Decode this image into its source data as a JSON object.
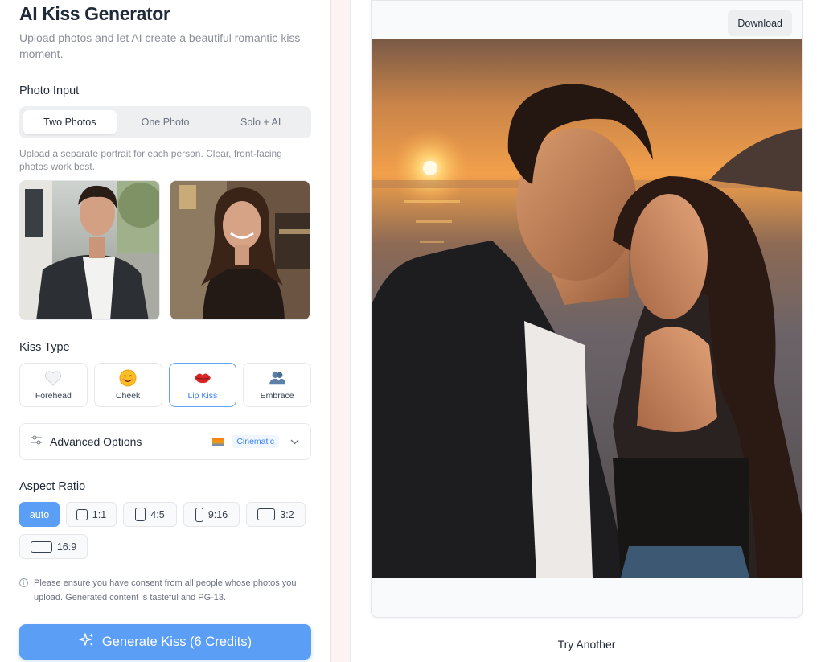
{
  "header": {
    "title": "AI Kiss Generator",
    "subtitle": "Upload photos and let AI create a beautiful romantic kiss moment."
  },
  "photo_input": {
    "label": "Photo Input",
    "tabs": [
      {
        "label": "Two Photos",
        "active": true
      },
      {
        "label": "One Photo",
        "active": false
      },
      {
        "label": "Solo + AI",
        "active": false
      }
    ],
    "hint": "Upload a separate portrait for each person. Clear, front-facing photos work best."
  },
  "kiss_type": {
    "label": "Kiss Type",
    "options": [
      {
        "label": "Forehead",
        "icon": "white-heart-icon",
        "active": false
      },
      {
        "label": "Cheek",
        "icon": "smiling-face-icon",
        "active": false
      },
      {
        "label": "Lip Kiss",
        "icon": "kiss-lips-icon",
        "active": true
      },
      {
        "label": "Embrace",
        "icon": "couple-icon",
        "active": false
      }
    ]
  },
  "advanced": {
    "label": "Advanced Options",
    "style_badge": "Cinematic"
  },
  "aspect_ratio": {
    "label": "Aspect Ratio",
    "options": [
      {
        "label": "auto",
        "active": true
      },
      {
        "label": "1:1",
        "active": false
      },
      {
        "label": "4:5",
        "active": false
      },
      {
        "label": "9:16",
        "active": false
      },
      {
        "label": "3:2",
        "active": false
      },
      {
        "label": "16:9",
        "active": false
      }
    ]
  },
  "consent": "Please ensure you have consent from all people whose photos you upload. Generated content is tasteful and PG-13.",
  "generate_button": "Generate Kiss (6 Credits)",
  "result": {
    "download_label": "Download",
    "try_another_label": "Try Another"
  },
  "colors": {
    "accent": "#5b9ef5",
    "accent_text": "#3b82f6",
    "strip": "#fdf3f3"
  }
}
